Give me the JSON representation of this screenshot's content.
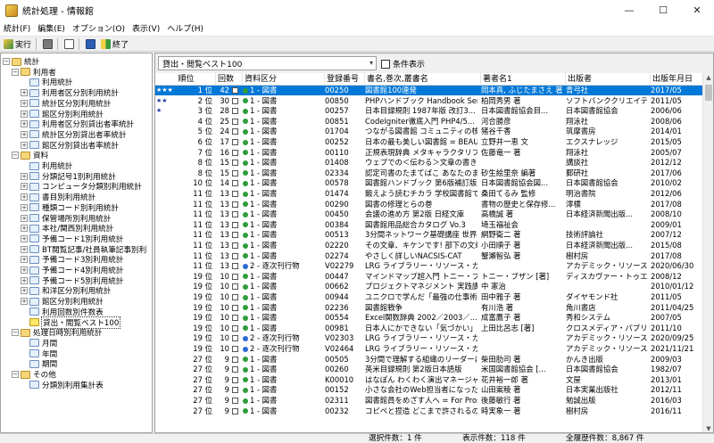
{
  "window": {
    "title": "統計処理 - 情報館",
    "minimize": "—",
    "maximize": "☐",
    "close": "✕"
  },
  "menu": [
    "統計(F)",
    "編集(E)",
    "オプション(O)",
    "表示(V)",
    "ヘルプ(H)"
  ],
  "toolbar": {
    "run": "実行",
    "exit": "終了"
  },
  "tree": [
    {
      "label": "統計",
      "level": 0,
      "exp": "−",
      "folder": true
    },
    {
      "label": "利用者",
      "level": 1,
      "exp": "−",
      "folder": true
    },
    {
      "label": "利用統計",
      "level": 2
    },
    {
      "label": "利用者区分別利用統計",
      "level": 2,
      "exp": "+"
    },
    {
      "label": "統計区分別利用統計",
      "level": 2,
      "exp": "+"
    },
    {
      "label": "館区分別利用統計",
      "level": 2,
      "exp": "+"
    },
    {
      "label": "利用者区分別貸出者率統計",
      "level": 2,
      "exp": "+"
    },
    {
      "label": "統計区分別貸出者率統計",
      "level": 2,
      "exp": "+"
    },
    {
      "label": "館区分別貸出者率統計",
      "level": 2,
      "exp": "+"
    },
    {
      "label": "資料",
      "level": 1,
      "exp": "−",
      "folder": true
    },
    {
      "label": "利用統計",
      "level": 2
    },
    {
      "label": "分類記号1別利用統計",
      "level": 2,
      "exp": "+"
    },
    {
      "label": "コンピュータ分類別利用統計",
      "level": 2,
      "exp": "+"
    },
    {
      "label": "書目別利用統計",
      "level": 2,
      "exp": "+"
    },
    {
      "label": "種類コード別利用統計",
      "level": 2,
      "exp": "+"
    },
    {
      "label": "保管場所別利用統計",
      "level": 2,
      "exp": "+"
    },
    {
      "label": "本社/関西別利用統計",
      "level": 2,
      "exp": "+"
    },
    {
      "label": "予備コード1別利用統計",
      "level": 2,
      "exp": "+"
    },
    {
      "label": "BT閲覧記事/社員執筆記事別利",
      "level": 2,
      "exp": "+"
    },
    {
      "label": "予備コード3別利用統計",
      "level": 2,
      "exp": "+"
    },
    {
      "label": "予備コード4別利用統計",
      "level": 2,
      "exp": "+"
    },
    {
      "label": "予備コード5別利用統計",
      "level": 2,
      "exp": "+"
    },
    {
      "label": "和洋区分別利用統計",
      "level": 2,
      "exp": "+"
    },
    {
      "label": "館区分別利用統計",
      "level": 2,
      "exp": "+"
    },
    {
      "label": "利用回数別件数表",
      "level": 2
    },
    {
      "label": "貸出・閲覧ベスト100",
      "level": 2,
      "selected": true
    },
    {
      "label": "処理日時別利用統計",
      "level": 1,
      "exp": "−",
      "folder": true
    },
    {
      "label": "月間",
      "level": 2
    },
    {
      "label": "年間",
      "level": 2
    },
    {
      "label": "期間",
      "level": 2
    },
    {
      "label": "その他",
      "level": 1,
      "exp": "−",
      "folder": true
    },
    {
      "label": "分類別利用集計表",
      "level": 2
    }
  ],
  "selector": {
    "value": "貸出・閲覧ベスト100",
    "arrow": "▾",
    "cond_label": "条件表示"
  },
  "columns": [
    "順位",
    "回数",
    "資料区分",
    "登録番号",
    "書名,巻次,叢書名",
    "著者名1",
    "出版者",
    "出版年月日"
  ],
  "rows": [
    {
      "stars": "★★★",
      "rank": "1 位",
      "count": "42",
      "type": "1 - 図書",
      "mono": true,
      "no": "00250",
      "title": "図書館100連発",
      "author": "岡本真, ふじたまさえ 著",
      "pub": "青弓社",
      "date": "2017/05",
      "selected": true
    },
    {
      "stars": "★★",
      "rank": "2 位",
      "count": "30",
      "type": "1 - 図書",
      "mono": true,
      "no": "00850",
      "title": "PHPハンドブック Handbook Seri...",
      "author": "柏岡秀男 著",
      "pub": "ソフトバンククリエイティ...",
      "date": "2011/05"
    },
    {
      "stars": "★",
      "rank": "3 位",
      "count": "28",
      "type": "1 - 図書",
      "mono": true,
      "no": "00257",
      "title": "日本目録規則 1987年版 改訂3...",
      "author": "日本図書館協会目...",
      "pub": "日本図書館協会",
      "date": "2006/06"
    },
    {
      "stars": "",
      "rank": "4 位",
      "count": "25",
      "type": "1 - 図書",
      "mono": true,
      "no": "00851",
      "title": "CodeIgniter徹底入門 PHP4/5...",
      "author": "河合勝彦",
      "pub": "翔泳社",
      "date": "2008/06"
    },
    {
      "stars": "",
      "rank": "5 位",
      "count": "24",
      "type": "1 - 図書",
      "mono": true,
      "no": "01704",
      "title": "つながる図書館 コミュニティの核と...",
      "author": "猪谷千香",
      "pub": "筑摩書房",
      "date": "2014/01"
    },
    {
      "stars": "",
      "rank": "6 位",
      "count": "17",
      "type": "1 - 図書",
      "mono": true,
      "no": "00252",
      "title": "日本の最も美しい図書館 = BEAUT...",
      "author": "立野井一恵 文",
      "pub": "エクスナレッジ",
      "date": "2015/05"
    },
    {
      "stars": "",
      "rank": "7 位",
      "count": "16",
      "type": "1 - 図書",
      "mono": true,
      "no": "00110",
      "title": "正規表現辞典 メタキャラクタリファレ...",
      "author": "佐藤竜一 著",
      "pub": "翔泳社",
      "date": "2005/07"
    },
    {
      "stars": "",
      "rank": "8 位",
      "count": "15",
      "type": "1 - 図書",
      "mono": true,
      "no": "01408",
      "title": "ウェブでの＜伝わる＞文章の書き方...",
      "author": "",
      "pub": "講談社",
      "date": "2012/12"
    },
    {
      "stars": "",
      "rank": "8 位",
      "count": "15",
      "type": "1 - 図書",
      "mono": true,
      "no": "02334",
      "title": "認定司書のたまてばこ あなたのまち...",
      "author": "砂生絵里奈 編著",
      "pub": "郵研社",
      "date": "2017/06"
    },
    {
      "stars": "",
      "rank": "10 位",
      "count": "14",
      "type": "1 - 図書",
      "mono": true,
      "no": "00578",
      "title": "図書館ハンドブック 第6版補訂版",
      "author": "日本図書館協会図...",
      "pub": "日本図書館協会",
      "date": "2010/02"
    },
    {
      "stars": "",
      "rank": "11 位",
      "count": "13",
      "type": "1 - 図書",
      "mono": true,
      "no": "01474",
      "title": "鍛えよう読むチカラ 学校図書館で...",
      "author": "桑田てるみ 監修",
      "pub": "明治書院",
      "date": "2012/06"
    },
    {
      "stars": "",
      "rank": "11 位",
      "count": "13",
      "type": "1 - 図書",
      "mono": true,
      "no": "00290",
      "title": "図書の修理とらの巻",
      "author": "書物の歴史と保存修...",
      "pub": "澪標",
      "date": "2017/08"
    },
    {
      "stars": "",
      "rank": "11 位",
      "count": "13",
      "type": "1 - 図書",
      "mono": true,
      "no": "00450",
      "title": "会議の進め方 第2版 日経文庫",
      "author": "高橋誠 著",
      "pub": "日本経済新聞出版...",
      "date": "2008/10"
    },
    {
      "stars": "",
      "rank": "11 位",
      "count": "13",
      "type": "1 - 図書",
      "mono": true,
      "no": "00384",
      "title": "図書館用品総合カタログ Vo.3",
      "author": "埼玉福祉会",
      "pub": "",
      "date": "2009/01"
    },
    {
      "stars": "",
      "rank": "11 位",
      "count": "13",
      "type": "1 - 図書",
      "mono": true,
      "no": "00513",
      "title": "3分間ネットワーク基礎講座 世界一...",
      "author": "網野衛二 著",
      "pub": "技術評論社",
      "date": "2007/12"
    },
    {
      "stars": "",
      "rank": "11 位",
      "count": "13",
      "type": "1 - 図書",
      "mono": true,
      "no": "02220",
      "title": "その文章、キケンです! 部下の文章...",
      "author": "小田順子 著",
      "pub": "日本経済新聞出版...",
      "date": "2015/08"
    },
    {
      "stars": "",
      "rank": "11 位",
      "count": "13",
      "type": "1 - 図書",
      "mono": true,
      "no": "02274",
      "title": "やさしく詳しいNACSIS-CAT",
      "author": "蟹瀬智弘 著",
      "pub": "樹村房",
      "date": "2017/08"
    },
    {
      "stars": "",
      "rank": "11 位",
      "count": "13",
      "type": "2 - 逐次刊行物",
      "mono": false,
      "no": "V02279",
      "title": "LRG ライブラリー・リソース・ガイド",
      "author": "",
      "pub": "アカデミック・リソース・...",
      "date": "2020/06/30"
    },
    {
      "stars": "",
      "rank": "19 位",
      "count": "10",
      "type": "1 - 図書",
      "mono": true,
      "no": "00447",
      "title": "マインドマップ超入門 トニー・ブザン天...",
      "author": "トニー・ブザン [著]",
      "pub": "ディスカヴァー・トゥエ...",
      "date": "2008/12"
    },
    {
      "stars": "",
      "rank": "19 位",
      "count": "10",
      "type": "1 - 図書",
      "mono": true,
      "no": "00662",
      "title": "プロジェクトマネジメント 実践講 通勤...",
      "author": "中 憲治",
      "pub": "",
      "date": "2010/01/12"
    },
    {
      "stars": "",
      "rank": "19 位",
      "count": "10",
      "type": "1 - 図書",
      "mono": true,
      "no": "00944",
      "title": "ユニクロで学んだ「最強の仕事術」...",
      "author": "田中雅子 著",
      "pub": "ダイヤモンド社",
      "date": "2011/05"
    },
    {
      "stars": "",
      "rank": "19 位",
      "count": "10",
      "type": "1 - 図書",
      "mono": true,
      "no": "02236",
      "title": "図書館戦争",
      "author": "有川浩 著",
      "pub": "角川書店",
      "date": "2011/04/25"
    },
    {
      "stars": "",
      "rank": "19 位",
      "count": "10",
      "type": "1 - 図書",
      "mono": true,
      "no": "00554",
      "title": "Excel関数辞典 2002／2003／...",
      "author": "成富鷹子 著",
      "pub": "秀和システム",
      "date": "2007/05"
    },
    {
      "stars": "",
      "rank": "19 位",
      "count": "10",
      "type": "1 - 図書",
      "mono": true,
      "no": "00981",
      "title": "日本人にかできない「気づかい」の...",
      "author": "上田比呂志 [著]",
      "pub": "クロスメディア・パブリ...",
      "date": "2011/10"
    },
    {
      "stars": "",
      "rank": "19 位",
      "count": "10",
      "type": "2 - 逐次刊行物",
      "mono": false,
      "no": "V02303",
      "title": "LRG ライブラリー・リソース・ガイド",
      "author": "",
      "pub": "アカデミック・リソース・...",
      "date": "2020/09/25"
    },
    {
      "stars": "",
      "rank": "19 位",
      "count": "10",
      "type": "2 - 逐次刊行物",
      "mono": false,
      "no": "V02464",
      "title": "LRG ライブラリー・リソース・ガイド",
      "author": "",
      "pub": "アカデミック・リソース・...",
      "date": "2021/11/21"
    },
    {
      "stars": "",
      "rank": "27 位",
      "count": "9",
      "type": "1 - 図書",
      "mono": true,
      "no": "00505",
      "title": "3分間で理解する組織のリーダーになる本",
      "author": "柴田肋司 著",
      "pub": "かんき出版",
      "date": "2009/03"
    },
    {
      "stars": "",
      "rank": "27 位",
      "count": "9",
      "type": "1 - 図書",
      "mono": true,
      "no": "00260",
      "title": "英米目録規則 第2版日本語版",
      "author": "米国図書館協会 [...",
      "pub": "日本図書館協会",
      "date": "1982/07"
    },
    {
      "stars": "",
      "rank": "27 位",
      "count": "9",
      "type": "1 - 図書",
      "mono": true,
      "no": "K00010",
      "title": "はなぽん わくわく演出マネージャー",
      "author": "花井裕一郎 著",
      "pub": "文屋",
      "date": "2013/01"
    },
    {
      "stars": "",
      "rank": "27 位",
      "count": "9",
      "type": "1 - 図書",
      "mono": true,
      "no": "00152",
      "title": "小さな会社のWeb担当者になったら...",
      "author": "山田案稜 著",
      "pub": "日本実業出版社",
      "date": "2012/11"
    },
    {
      "stars": "",
      "rank": "27 位",
      "count": "9",
      "type": "1 - 図書",
      "mono": true,
      "no": "02311",
      "title": "図書館員をめざす人へ = For Prosp...",
      "author": "後藤敏行 著",
      "pub": "勉誠出版",
      "date": "2016/03"
    },
    {
      "stars": "",
      "rank": "27 位",
      "count": "9",
      "type": "1 - 図書",
      "mono": true,
      "no": "00232",
      "title": "コピペと捏造 どこまで許されるのか、...",
      "author": "時実象一 著",
      "pub": "樹村房",
      "date": "2016/11"
    }
  ],
  "status": {
    "selected": "選択件数：1 件",
    "shown": "表示件数：118 件",
    "total": "全履歴件数：8,867 件"
  },
  "colors": {
    "selection": "#0078d7"
  }
}
